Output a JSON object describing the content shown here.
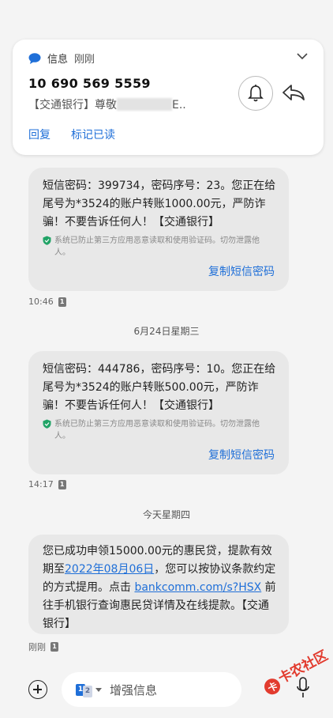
{
  "notification": {
    "app": "信息",
    "time": "刚刚",
    "sender": "10 690 569 5559",
    "preview_prefix": "【交通银行】尊敬",
    "preview_suffix": "E..",
    "actions": [
      "回复",
      "标记已读"
    ]
  },
  "messages": [
    {
      "text": "短信密码：399734，密码序号：23。您正在给尾号为*3524的账户转账1000.00元，严防诈骗！不要告诉任何人！【交通银行】",
      "guard": "系统已防止第三方应用恶意读取和使用验证码。切勿泄露他人。",
      "copy": "复制短信密码",
      "time": "10:46",
      "sim": "1"
    },
    {
      "text": "短信密码：444786，密码序号：10。您正在给尾号为*3524的账户转账500.00元，严防诈骗！不要告诉任何人！【交通银行】",
      "guard": "系统已防止第三方应用恶意读取和使用验证码。切勿泄露他人。",
      "copy": "复制短信密码",
      "time": "14:17",
      "sim": "1"
    },
    {
      "text_before": "您已成功申领15000.00元的惠民贷，提款有效期至",
      "date_link": "2022年08月06日",
      "text_middle": "，您可以按协议条款约定的方式提用。点击 ",
      "url": "bankcomm.com/s?HSX",
      "text_after": " 前往手机银行查询惠民贷详情及在线提款。【交通银行】",
      "time": "刚刚",
      "sim": "1"
    }
  ],
  "date_separators": [
    "6月24日星期三",
    "今天星期四"
  ],
  "composer": {
    "placeholder": "增强信息",
    "sim_primary": "1",
    "sim_secondary": "2"
  },
  "watermark": "卡农社区",
  "colors": {
    "accent": "#1f6fd8",
    "bubble": "#e8e8e8",
    "background": "#f4f4f4",
    "guard": "#21a366"
  }
}
